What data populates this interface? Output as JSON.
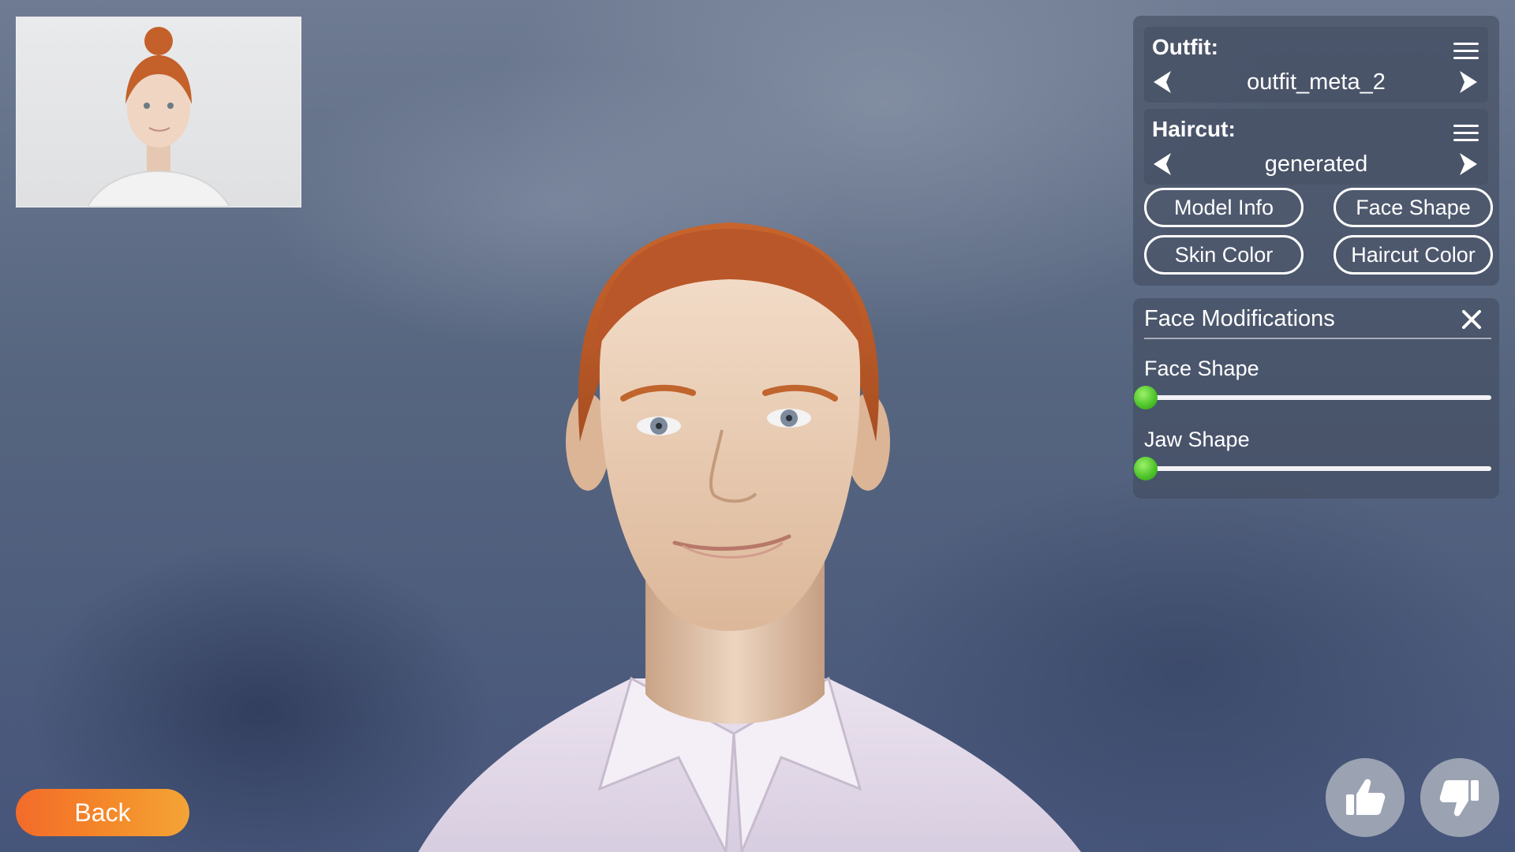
{
  "outfit": {
    "label": "Outfit:",
    "value": "outfit_meta_2"
  },
  "haircut": {
    "label": "Haircut:",
    "value": "generated"
  },
  "buttons": {
    "model_info": "Model Info",
    "face_shape": "Face Shape",
    "skin_color": "Skin Color",
    "haircut_color": "Haircut Color"
  },
  "face_mods": {
    "title": "Face Modifications",
    "sliders": [
      {
        "label": "Face Shape",
        "value": 0
      },
      {
        "label": "Jaw Shape",
        "value": 0
      }
    ]
  },
  "back_label": "Back",
  "icons": {
    "outfit_menu": "hamburger-menu-icon",
    "haircut_menu": "hamburger-menu-icon",
    "prev": "chevron-left-icon",
    "next": "chevron-right-icon",
    "close": "close-icon",
    "like": "thumbs-up-icon",
    "dislike": "thumbs-down-icon"
  },
  "colors": {
    "accent_orange": "#f47a2b",
    "slider_knob": "#4fc62a",
    "hair": "#c9652c"
  }
}
